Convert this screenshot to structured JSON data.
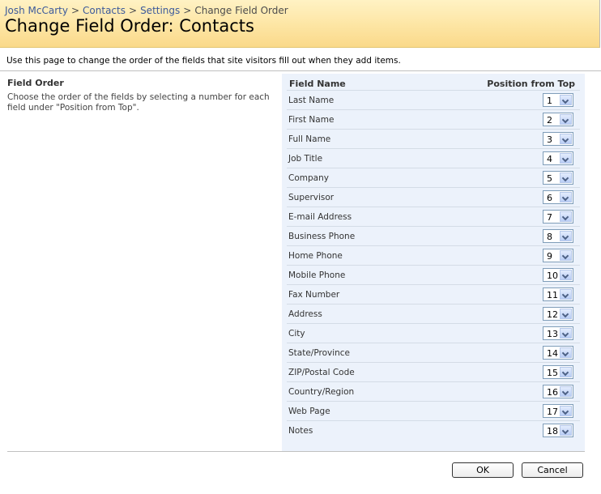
{
  "breadcrumb": {
    "items": [
      "Josh McCarty",
      "Contacts",
      "Settings"
    ],
    "current": "Change Field Order",
    "separator": ">"
  },
  "page_title": "Change Field Order: Contacts",
  "description": "Use this page to change the order of the fields that site visitors fill out when they add items.",
  "section": {
    "title": "Field Order",
    "description": "Choose the order of the fields by selecting a number for each field under \"Position from Top\"."
  },
  "table": {
    "col_name": "Field Name",
    "col_position": "Position from Top",
    "rows": [
      {
        "name": "Last Name",
        "position": "1"
      },
      {
        "name": "First Name",
        "position": "2"
      },
      {
        "name": "Full Name",
        "position": "3"
      },
      {
        "name": "Job Title",
        "position": "4"
      },
      {
        "name": "Company",
        "position": "5"
      },
      {
        "name": "Supervisor",
        "position": "6"
      },
      {
        "name": "E-mail Address",
        "position": "7"
      },
      {
        "name": "Business Phone",
        "position": "8"
      },
      {
        "name": "Home Phone",
        "position": "9"
      },
      {
        "name": "Mobile Phone",
        "position": "10"
      },
      {
        "name": "Fax Number",
        "position": "11"
      },
      {
        "name": "Address",
        "position": "12"
      },
      {
        "name": "City",
        "position": "13"
      },
      {
        "name": "State/Province",
        "position": "14"
      },
      {
        "name": "ZIP/Postal Code",
        "position": "15"
      },
      {
        "name": "Country/Region",
        "position": "16"
      },
      {
        "name": "Web Page",
        "position": "17"
      },
      {
        "name": "Notes",
        "position": "18"
      }
    ]
  },
  "buttons": {
    "ok": "OK",
    "cancel": "Cancel"
  },
  "colors": {
    "header_bg": "#fde5a3",
    "link": "#3c5a9b",
    "panel_bg": "#ecf2fb"
  },
  "icons": {
    "dropdown": "chevron-down-icon"
  }
}
